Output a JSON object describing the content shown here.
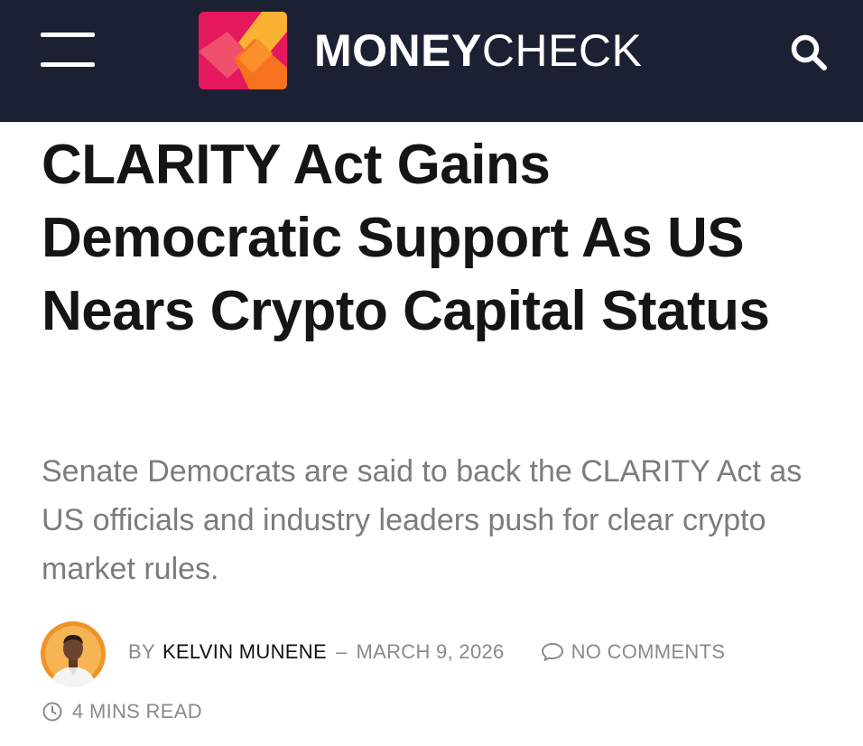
{
  "header": {
    "brand_primary": "MONEY",
    "brand_secondary": "CHECK",
    "background_color": "#1c2033",
    "menu_icon": "hamburger-menu-icon",
    "search_icon": "search-icon",
    "logo_icon": "moneycheck-logo-icon"
  },
  "article": {
    "title": "CLARITY Act Gains Democratic Support As US Nears Crypto Capital Status",
    "subtitle": "Senate Democrats are said to back the CLARITY Act as US officials and industry leaders push for clear crypto market rules.",
    "byline": {
      "by_label": "BY",
      "author": "KELVIN MUNENE",
      "separator": "–",
      "date": "MARCH 9, 2026",
      "comments_label": "NO COMMENTS",
      "comments_icon": "comment-bubble-icon"
    },
    "read_time": "4 MINS READ",
    "read_time_icon": "clock-icon"
  },
  "colors": {
    "title": "#151515",
    "subtitle": "#7c7c7c",
    "meta": "#8a8a8a",
    "logo_pink": "#e6185d",
    "logo_orange": "#f7721e",
    "logo_yellow": "#f9b233"
  }
}
